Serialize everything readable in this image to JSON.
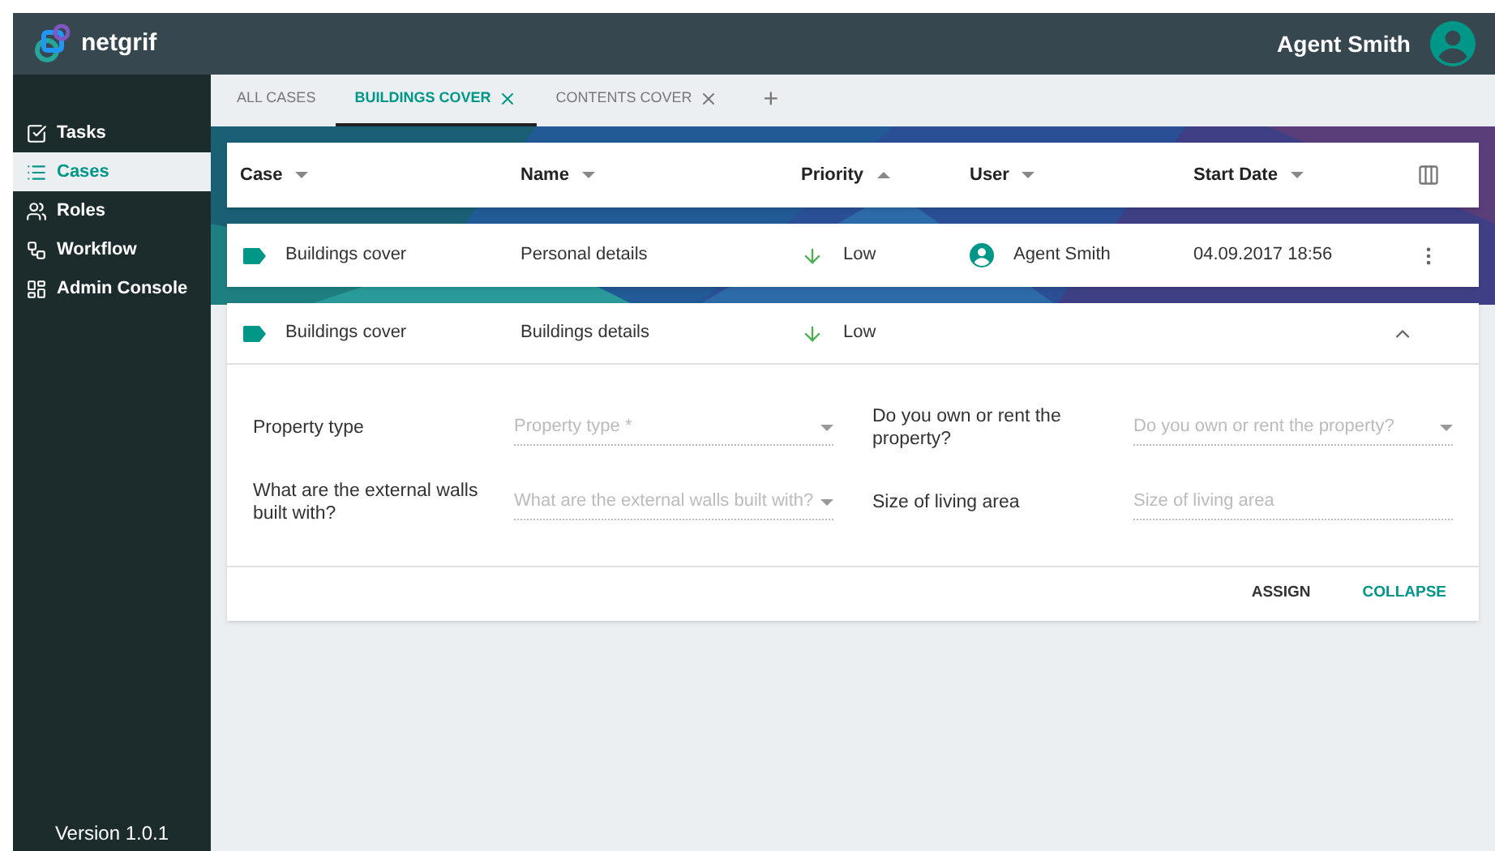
{
  "header": {
    "logo": "netgrif",
    "user": "Agent Smith"
  },
  "sidebar": {
    "items": [
      {
        "label": "Tasks",
        "selected": false
      },
      {
        "label": "Cases",
        "selected": true
      },
      {
        "label": "Roles",
        "selected": false
      },
      {
        "label": "Workflow",
        "selected": false
      },
      {
        "label": "Admin Console",
        "selected": false
      }
    ],
    "version": "Version 1.0.1"
  },
  "tabs": [
    {
      "label": "ALL CASES",
      "selected": false,
      "closable": false
    },
    {
      "label": "BUILDINGS COVER",
      "selected": true,
      "closable": true
    },
    {
      "label": "CONTENTS COVER",
      "selected": false,
      "closable": true
    }
  ],
  "add_tab": "+",
  "table": {
    "columns": [
      {
        "label": "Case",
        "sort_ascending": false
      },
      {
        "label": "Name",
        "sort_ascending": false
      },
      {
        "label": "Priority",
        "sort_ascending": true
      },
      {
        "label": "User",
        "sort_ascending": false
      },
      {
        "label": "Start Date",
        "sort_ascending": false
      }
    ],
    "rows": [
      {
        "case": "Buildings cover",
        "name": "Personal details",
        "priority": "Low",
        "user": "Agent Smith",
        "start_date": "04.09.2017 18:56",
        "expanded": false
      },
      {
        "case": "Buildings cover",
        "name": "Buildings details",
        "priority": "Low",
        "expanded": true,
        "fields": [
          {
            "label": "Property type",
            "placeholder": "Property type *",
            "kind": "select"
          },
          {
            "label": "Do you own or rent the property?",
            "placeholder": "Do you own or rent the property?",
            "kind": "select"
          },
          {
            "label": "What are the external walls built with?",
            "placeholder": "What are the external walls built with?",
            "kind": "select"
          },
          {
            "label": "Size of living area",
            "placeholder": "Size of living area",
            "kind": "text"
          }
        ],
        "actions": [
          {
            "label": "ASSIGN",
            "primary": false
          },
          {
            "label": "COLLAPSE",
            "primary": true
          }
        ]
      }
    ]
  }
}
